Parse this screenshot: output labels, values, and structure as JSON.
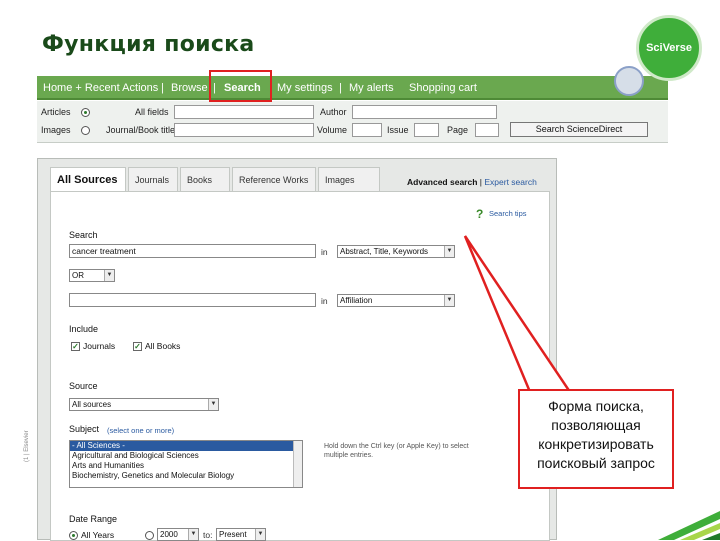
{
  "slide": {
    "title": "Функция поиска",
    "logo_text": "SciVerse",
    "side_note": "(1 | Elsevier"
  },
  "nav": {
    "items": [
      "Home + Recent Actions",
      "Browse",
      "Search",
      "My settings",
      "My alerts",
      "Shopping cart"
    ],
    "separator": "|"
  },
  "quick_search": {
    "radio_articles": "Articles",
    "radio_images": "Images",
    "all_fields_label": "All fields",
    "journal_label": "Journal/Book title",
    "author_label": "Author",
    "volume_label": "Volume",
    "issue_label": "Issue",
    "page_label": "Page",
    "button_label": "Search ScienceDirect"
  },
  "search_form": {
    "tabs": [
      "All Sources",
      "Journals",
      "Books",
      "Reference Works",
      "Images"
    ],
    "advanced_search": "Advanced search",
    "link_sep": "|",
    "expert_search": "Expert search",
    "help_icon": "?",
    "search_tips": "Search tips",
    "search_label": "Search",
    "search_value": "cancer treatment",
    "in_label": "in",
    "field1_value": "Abstract, Title, Keywords",
    "bool_value": "OR",
    "field2_value": "Affiliation",
    "include_label": "Include",
    "check_journals": "Journals",
    "check_books": "All Books",
    "source_label": "Source",
    "source_value": "All sources",
    "subject_label": "Subject",
    "subject_hint_link": "(select one or more)",
    "subject_items": [
      "- All Sciences -",
      "Agricultural and Biological Sciences",
      "Arts and Humanities",
      "Biochemistry, Genetics and Molecular Biology"
    ],
    "subject_hint": "Hold down the Ctrl key (or Apple Key) to select multiple entries.",
    "date_range_label": "Date Range",
    "all_years": "All Years",
    "year_from": "2000",
    "to_label": "to:",
    "year_to": "Present"
  },
  "callout": {
    "text": "Форма поиска, позволяющая конкретизировать поисковый запрос"
  },
  "colors": {
    "nav_green": "#6aa84f",
    "highlight_red": "#e02020",
    "logo_green": "#3fae3a"
  }
}
